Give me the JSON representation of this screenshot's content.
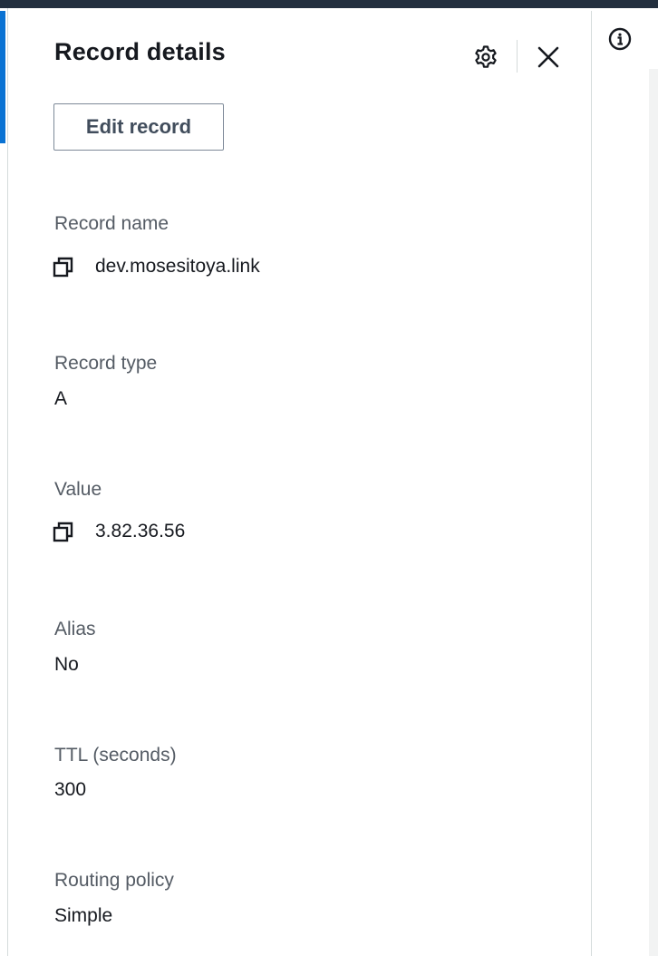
{
  "panel": {
    "title": "Record details",
    "edit_button_label": "Edit record"
  },
  "icons": {
    "settings": "gear-icon",
    "close": "close-icon",
    "info": "info-icon",
    "copy": "copy-icon",
    "resize": "drag-handle-icon"
  },
  "fields": {
    "record_name": {
      "label": "Record name",
      "value": "dev.mosesitoya.link"
    },
    "record_type": {
      "label": "Record type",
      "value": "A"
    },
    "value": {
      "label": "Value",
      "value": "3.82.36.56"
    },
    "alias": {
      "label": "Alias",
      "value": "No"
    },
    "ttl": {
      "label": "TTL (seconds)",
      "value": "300"
    },
    "routing_policy": {
      "label": "Routing policy",
      "value": "Simple"
    }
  },
  "colors": {
    "topbar": "#232f3e",
    "accent": "#0972d3",
    "label_text": "#545b64",
    "value_text": "#16191f",
    "button_border": "#7d8998"
  }
}
